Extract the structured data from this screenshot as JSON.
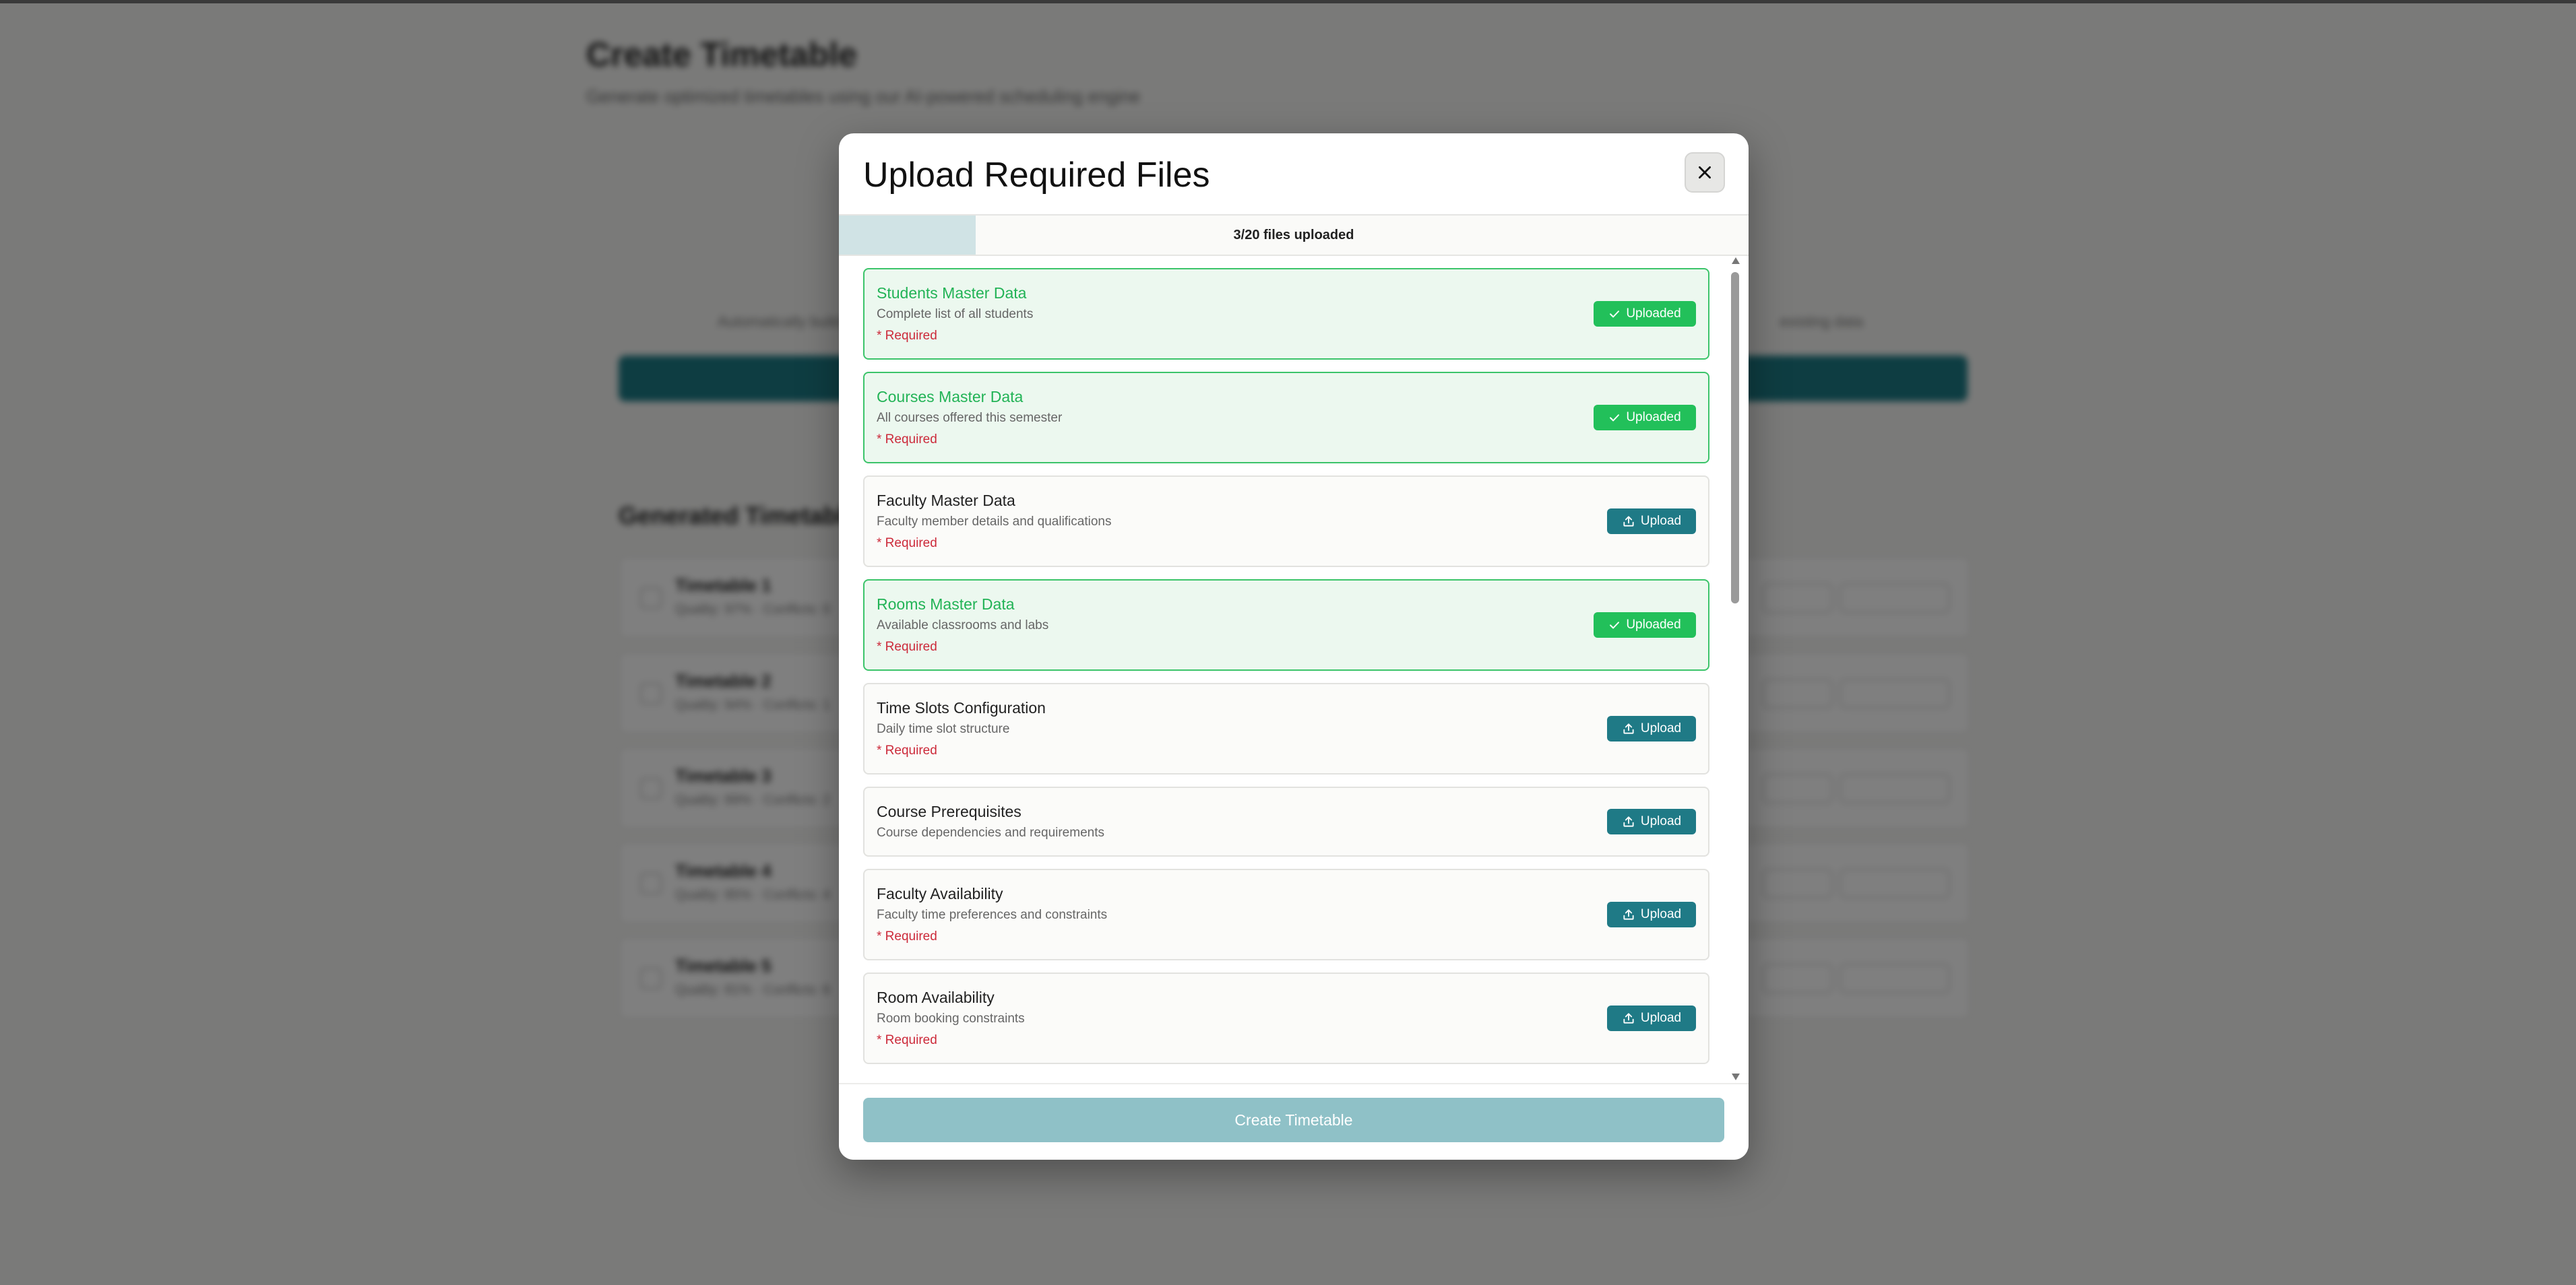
{
  "background_page": {
    "title": "Create Timetable",
    "subtitle": "Generate optimized timetables using our AI-powered scheduling engine",
    "note_left": "Automatically build",
    "note_right": "existing data",
    "section_title": "Generated Timetables",
    "rows": [
      {
        "name": "Timetable 1",
        "meta": "Quality: 97% · Conflicts: 0"
      },
      {
        "name": "Timetable 2",
        "meta": "Quality: 94% · Conflicts: 1"
      },
      {
        "name": "Timetable 3",
        "meta": "Quality: 89% · Conflicts: 2"
      },
      {
        "name": "Timetable 4",
        "meta": "Quality: 85% · Conflicts: 4"
      },
      {
        "name": "Timetable 5",
        "meta": "Quality: 81% · Conflicts: 6"
      }
    ],
    "row_view_label": "View",
    "row_download_label": "Download"
  },
  "modal": {
    "title": "Upload Required Files",
    "close_icon": "close-icon",
    "progress": {
      "uploaded": 3,
      "total": 20,
      "fraction": 0.15,
      "label": "3/20 files uploaded"
    },
    "files": [
      {
        "name": "Students Master Data",
        "description": "Complete list of all students",
        "required": "* Required",
        "status": "uploaded",
        "button_label": "Uploaded"
      },
      {
        "name": "Courses Master Data",
        "description": "All courses offered this semester",
        "required": "* Required",
        "status": "uploaded",
        "button_label": "Uploaded"
      },
      {
        "name": "Faculty Master Data",
        "description": "Faculty member details and qualifications",
        "required": "* Required",
        "status": "pending",
        "button_label": "Upload"
      },
      {
        "name": "Rooms Master Data",
        "description": "Available classrooms and labs",
        "required": "* Required",
        "status": "uploaded",
        "button_label": "Uploaded"
      },
      {
        "name": "Time Slots Configuration",
        "description": "Daily time slot structure",
        "required": "* Required",
        "status": "pending",
        "button_label": "Upload"
      },
      {
        "name": "Course Prerequisites",
        "description": "Course dependencies and requirements",
        "required": "",
        "status": "pending",
        "button_label": "Upload"
      },
      {
        "name": "Faculty Availability",
        "description": "Faculty time preferences and constraints",
        "required": "* Required",
        "status": "pending",
        "button_label": "Upload"
      },
      {
        "name": "Room Availability",
        "description": "Room booking constraints",
        "required": "* Required",
        "status": "pending",
        "button_label": "Upload"
      }
    ],
    "create_button": "Create Timetable"
  },
  "colors": {
    "accent": "#1f7a86",
    "success": "#22c05a",
    "required": "#cc2a3a",
    "create_disabled": "#8fc1c7"
  }
}
